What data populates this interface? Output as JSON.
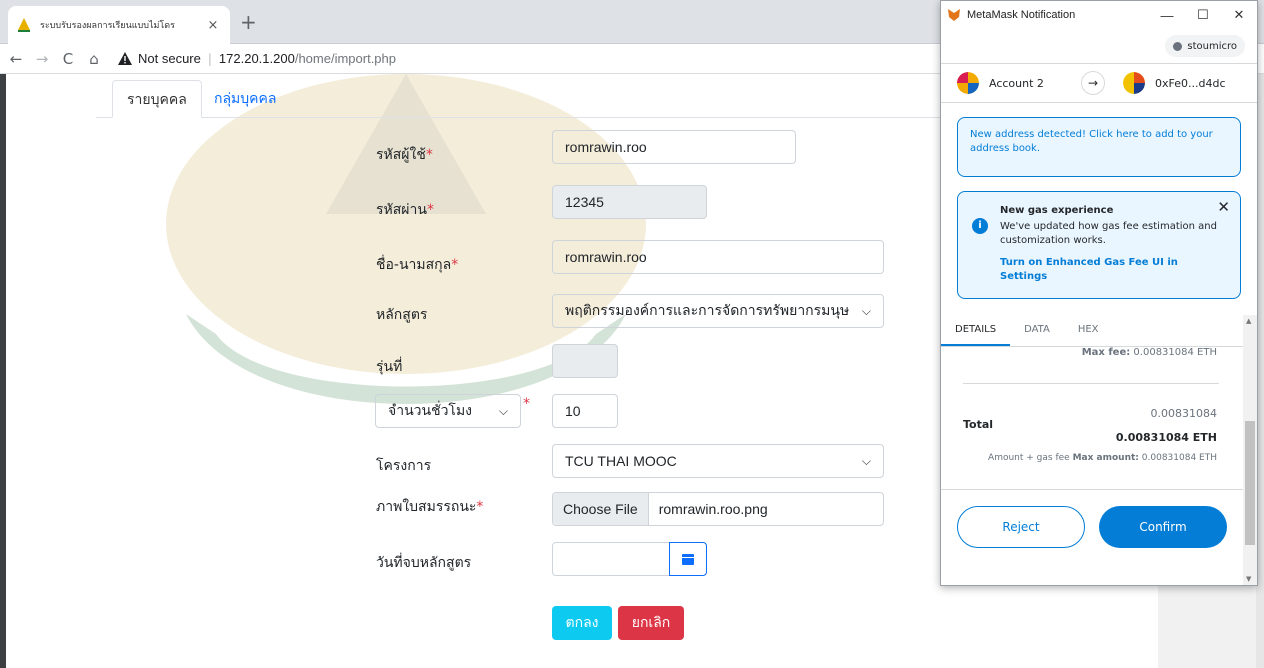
{
  "browser": {
    "tab_title": "ระบบรับรองผลการเรียนแบบไม่โดร",
    "tab_close": "×",
    "new_tab": "+",
    "back": "←",
    "forward": "→",
    "reload": "C",
    "home": "⌂",
    "not_secure": "Not secure",
    "url_sep": "|",
    "url_host": "172.20.1.200",
    "url_path": "/home/import.php"
  },
  "page": {
    "tabs": [
      {
        "label": "รายบุคคล",
        "active": true
      },
      {
        "label": "กลุ่มบุคคล",
        "active": false
      }
    ],
    "form": {
      "username_label": "รหัสผู้ใช้",
      "username_value": "romrawin.roo",
      "password_label": "รหัสผ่าน",
      "password_value": "12345",
      "fullname_label": "ชื่อ-นามสกุล",
      "fullname_value": "romrawin.roo",
      "course_label": "หลักสูตร",
      "course_value": "พฤติกรรมองค์การและการจัดการทรัพยากรมนุษ",
      "batch_label": "รุ่นที่",
      "batch_value": "",
      "hours_select": "จำนวนชั่วโมง",
      "hours_value": "10",
      "project_label": "โครงการ",
      "project_value": "TCU THAI MOOC",
      "cert_label": "ภาพใบสมรรถนะ",
      "choose_file": "Choose File",
      "file_name": "romrawin.roo.png",
      "end_date_label": "วันที่จบหลักสูตร",
      "end_date_value": "",
      "required_mark": "*",
      "ok_label": "ตกลง",
      "cancel_label": "ยกเลิก"
    }
  },
  "metamask": {
    "window_title": "MetaMask Notification",
    "minimize": "—",
    "maximize": "☐",
    "close": "✕",
    "network": "stoumicro",
    "from_account": "Account 2",
    "arrow": "→",
    "to_address": "0xFe0...d4dc",
    "alert_new_address": "New address detected! Click here to add to your address book.",
    "gas_title": "New gas experience",
    "gas_body": "We've updated how gas fee estimation and customization works.",
    "gas_link": "Turn on Enhanced Gas Fee UI in Settings",
    "gas_close": "✕",
    "info_symbol": "i",
    "tabs": [
      "DETAILS",
      "DATA",
      "HEX"
    ],
    "max_fee_label": "Max fee:",
    "max_fee_value": "0.00831084 ETH",
    "total_label": "Total",
    "total_value": "0.00831084",
    "total_eth": "0.00831084 ETH",
    "amount_gas_label": "Amount + gas fee",
    "max_amount_label": "Max amount:",
    "max_amount_value": "0.00831084 ETH",
    "reject_label": "Reject",
    "confirm_label": "Confirm"
  },
  "colors": {
    "metamask_blue": "#037dd6",
    "link_blue": "#0d6efd",
    "ok_button": "#0dcaf0",
    "cancel_button": "#dc3545",
    "required": "#dc3545"
  }
}
